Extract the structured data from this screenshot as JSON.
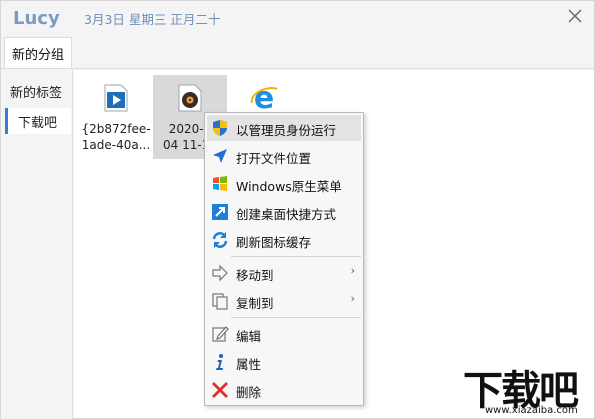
{
  "app": {
    "title": "Lucy",
    "date": "3月3日 星期三 正月二十"
  },
  "groups": {
    "active_tab": "新的分组"
  },
  "sidebar": {
    "items": [
      {
        "label": "新的标签"
      },
      {
        "label": "下载吧"
      }
    ]
  },
  "files": [
    {
      "name_line1": "{2b872fee-",
      "name_line2": "1ade-40a...",
      "icon": "media-player-icon"
    },
    {
      "name_line1": "2020-1",
      "name_line2": "04 11-14",
      "icon": "music-disc-icon"
    },
    {
      "name_line1": "",
      "name_line2": "",
      "icon": "internet-explorer-icon"
    }
  ],
  "context_menu": {
    "items": [
      {
        "label": "以管理员身份运行",
        "icon": "shield-icon"
      },
      {
        "label": "打开文件位置",
        "icon": "location-arrow-icon"
      },
      {
        "label": "Windows原生菜单",
        "icon": "windows-logo-icon"
      },
      {
        "label": "创建桌面快捷方式",
        "icon": "shortcut-icon"
      },
      {
        "label": "刷新图标缓存",
        "icon": "refresh-icon"
      },
      {
        "label": "移动到",
        "icon": "move-icon",
        "arrow": "›"
      },
      {
        "label": "复制到",
        "icon": "copy-icon",
        "arrow": "›"
      },
      {
        "label": "编辑",
        "icon": "edit-icon"
      },
      {
        "label": "属性",
        "icon": "info-icon"
      },
      {
        "label": "删除",
        "icon": "delete-icon"
      }
    ]
  },
  "watermark": {
    "text": "下载吧",
    "url": "www.xiazaiba.com"
  },
  "colors": {
    "accent": "#3c7bd4",
    "title": "#7a9bc4",
    "selected": "#d9d9d9",
    "delete": "#e0302c"
  }
}
